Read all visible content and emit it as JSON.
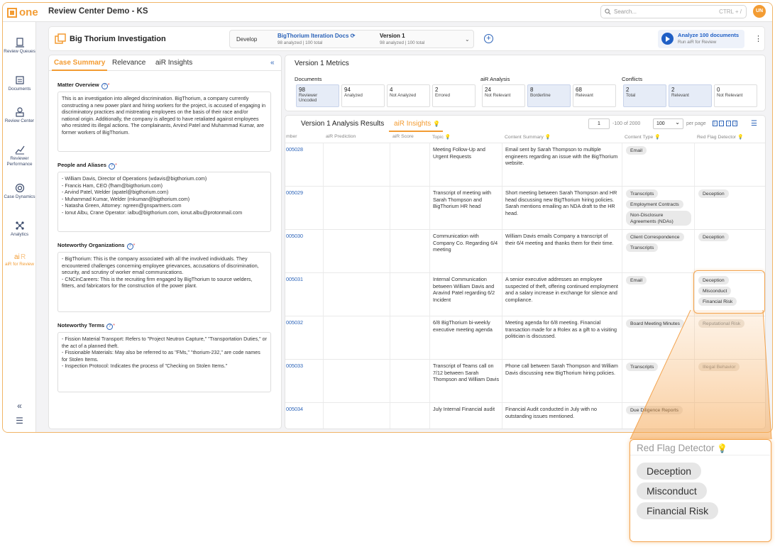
{
  "app": {
    "logo_text": "one",
    "title": "Review Center Demo - KS",
    "search_placeholder": "Search...",
    "search_shortcut": "CTRL + /",
    "user_initials": "UN"
  },
  "sidebar": {
    "items": [
      {
        "label": "Review Queues",
        "icon": "review-queues-icon"
      },
      {
        "label": "Documents",
        "icon": "documents-icon"
      },
      {
        "label": "Review Center",
        "icon": "review-center-icon"
      },
      {
        "label": "Reviewer Performance",
        "icon": "chart-icon"
      },
      {
        "label": "Case Dynamics",
        "icon": "target-icon"
      },
      {
        "label": "Analytics",
        "icon": "network-icon"
      },
      {
        "label": "aiR for Review",
        "icon": "air-icon"
      }
    ]
  },
  "header": {
    "case_title": "Big Thorium Investigation",
    "environment": "Develop",
    "docs_name": "BigThorium Iteration Docs",
    "docs_sub": "98 analyzed | 100 total",
    "version_name": "Version 1",
    "version_sub": "98 analyzed | 100 total",
    "analyze_label": "Analyze 100 documents",
    "analyze_sub": "Run aiR for Review"
  },
  "left_panel": {
    "tabs": [
      "Case Summary",
      "Relevance",
      "aiR Insights"
    ],
    "active_tab": "Case Summary",
    "sections": [
      {
        "title": "Matter Overview",
        "lines": [
          "This is an investigation into alleged discrimination. BigThorium, a company currently constructing a new power plant and hiring workers for the project, is accused of engaging in discriminatory practices and mistreating employees on the basis of their race and/or national origin. Additionally, the company is alleged to have retaliated against employees who resisted its illegal actions. The complainants, Arvind Patel and Muhammad Kumar, are former workers of BigThorium."
        ]
      },
      {
        "title": "People and Aliases",
        "lines": [
          "- William Davis, Director of Operations (wdavis@bigthorium.com)",
          "- Francis Ham, CEO (fham@bigthorium.com)",
          "- Arvind Patel, Welder (apatel@bigthorium.com)",
          "- Muhammad Kumar, Welder (mkuman@bigthorium.com)",
          "- Natasha Green, Attorney: ngreen@gnspartners.com",
          "- Ionut Albu, Crane Operator: ialbu@bigthorium.com, ionut.albu@protonmail.com"
        ]
      },
      {
        "title": "Noteworthy Organizations",
        "lines": [
          "- BigThorium: This is the company associated with all the involved individuals. They encountered challenges concerning employee grievances, accusations of discrimination, security, and scrutiny of worker email communications.",
          "- CNCinCareers: This is the recruiting firm engaged by BigThorium to source welders, fitters, and fabricators for the construction of the power plant."
        ]
      },
      {
        "title": "Noteworthy Terms",
        "lines": [
          "- Fission Material Transport: Refers to \"Project Neutron Capture,\" \"Transportation Duties,\" or the act of a planned theft.",
          "- Fissionable Materials: May also be referred to as \"FMs,\" \"thorium-232,\" are code names for Stolen Items.",
          "- Inspection Protocol: Indicates the process of \"Checking on Stolen Items.\""
        ]
      }
    ]
  },
  "metrics": {
    "title": "Version 1 Metrics",
    "groups": [
      {
        "label": "Documents",
        "cards": [
          {
            "value": "98",
            "label": "Reviewer Uncoded",
            "hl": true
          },
          {
            "value": "94",
            "label": "Analyzed",
            "hl": false
          },
          {
            "value": "4",
            "label": "Not Analyzed",
            "hl": false
          },
          {
            "value": "2",
            "label": "Errored",
            "hl": false
          }
        ]
      },
      {
        "label": "aiR Analysis",
        "cards": [
          {
            "value": "24",
            "label": "Not Relevant",
            "hl": false
          },
          {
            "value": "8",
            "label": "Borderline",
            "hl": true
          },
          {
            "value": "68",
            "label": "Relevant",
            "hl": false
          }
        ]
      },
      {
        "label": "Conflicts",
        "cards": [
          {
            "value": "2",
            "label": "Total",
            "hl": true
          },
          {
            "value": "2",
            "label": "Relevant",
            "hl": true
          },
          {
            "value": "0",
            "label": "Not Relevant",
            "hl": false
          }
        ]
      }
    ]
  },
  "results": {
    "tabs": [
      "Version 1 Analysis Results",
      "aiR Insights"
    ],
    "active_tab": "aiR Insights",
    "page": "1",
    "page_of": "-100 of 2000",
    "page_size": "100",
    "per_page": "per page",
    "columns": [
      "mber",
      "aiR Prediction",
      "aiR Score",
      "Topic",
      "Content Summary",
      "Content Type",
      "Red Flag Detector"
    ],
    "rows": [
      {
        "doc": "005028",
        "topic": "Meeting Follow-Up and Urgent Requests",
        "summary": "Email sent by Sarah Thompson to multiple engineers regarding an issue with the BigThorium website.",
        "types": [
          "Email"
        ],
        "flags": []
      },
      {
        "doc": "005029",
        "topic": "Transcript of meeting with Sarah Thompson and BigThorium HR head",
        "summary": "Short meeting between Sarah Thompson and HR head discussing new BigThorium hiring policies. Sarah mentions emailing an NDA draft to the HR head.",
        "types": [
          "Transcripts",
          "Employment Contracts",
          "Non-Disclosure Agreements (NDAs)"
        ],
        "flags": [
          "Deception"
        ]
      },
      {
        "doc": "005030",
        "topic": "Communication with Company Co. Regarding 6/4 meeting",
        "summary": "William Davis emails Company a transcript of their 6/4 meeting and thanks them for their time.",
        "types": [
          "Client Correspondence",
          "Transcripts"
        ],
        "flags": [
          "Deception"
        ]
      },
      {
        "doc": "005031",
        "topic": "Internal Communication between William Davis and Aravind Patel regarding 6/2 Incident",
        "summary": "A senior executive addresses an employee suspected of theft, offering continued employment and a salary increase in exchange for silence and compliance.",
        "types": [
          "Email"
        ],
        "flags": [
          "Deception",
          "Misconduct",
          "Financial Risk"
        ]
      },
      {
        "doc": "005032",
        "topic": "6/8 BigThorium bi-weekly executive meeting agenda",
        "summary": "Meeting agenda for 6/8 meeting. Financial transaction made for a Rolex as a gift to a visiting politician is discussed.",
        "types": [
          "Board Meeting Minutes"
        ],
        "flags": [
          "Reputational Risk"
        ]
      },
      {
        "doc": "005033",
        "topic": "Transcript of Teams call on 7/12 between Sarah Thompson and William Davis",
        "summary": "Phone call between Sarah Thompson and William Davis discussing new BigThorium hiring policies.",
        "types": [
          "Transcripts"
        ],
        "flags": [
          "Illegal Behavior"
        ]
      },
      {
        "doc": "005034",
        "topic": "July Internal Financial audit",
        "summary": "Financial Audit conducted in July with no outstanding issues mentioned.",
        "types": [
          "Due Diligence Reports"
        ],
        "flags": []
      }
    ]
  },
  "zoom": {
    "title": "Red Flag Detector",
    "flags": [
      "Deception",
      "Misconduct",
      "Financial Risk"
    ]
  },
  "colors": {
    "accent": "#f39c33",
    "link": "#2a62b8",
    "highlight_card": "#e6ecf7"
  }
}
